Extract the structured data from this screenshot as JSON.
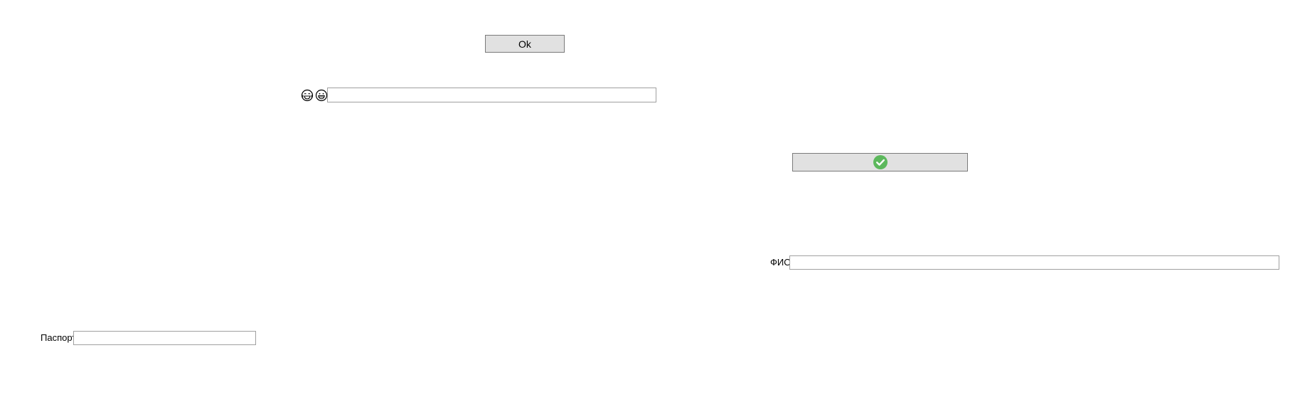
{
  "ok_button": {
    "label": "Ok"
  },
  "emoji_row": {
    "icons": [
      "grinning-with-tears-icon",
      "grinning-face-icon"
    ],
    "input_value": "",
    "input_placeholder": ""
  },
  "confirm_button": {
    "icon": "check-circle-icon",
    "colors": {
      "circle": "#5cb85c",
      "check": "#ffffff"
    }
  },
  "fio_field": {
    "label": "ФИО",
    "value": "",
    "placeholder": ""
  },
  "passport_field": {
    "label": "Паспорт",
    "value": "",
    "placeholder": ""
  }
}
